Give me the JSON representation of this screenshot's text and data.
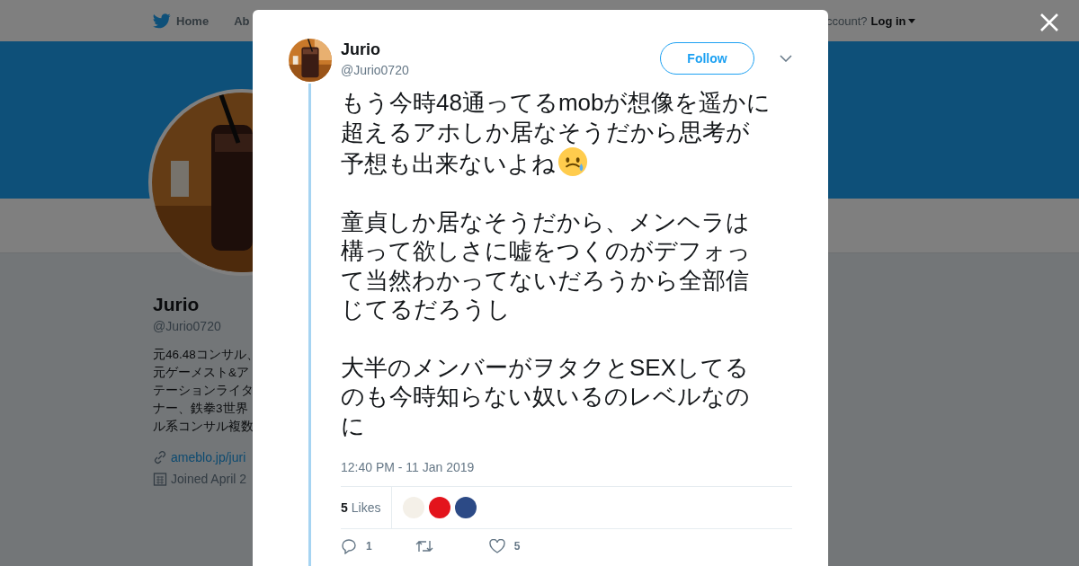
{
  "nav": {
    "home": "Home",
    "about": "Ab",
    "account": "ccount?",
    "login": "Log in"
  },
  "profile": {
    "name": "Jurio",
    "handle": "@Jurio0720",
    "bio_lines": [
      "元46.48コンサル、",
      "元ゲーメスト&ア",
      "テーションライタ",
      "ナー、鉄拳3世界",
      "ル系コンサル複数"
    ],
    "link": "ameblo.jp/juri",
    "joined": "Joined April 2"
  },
  "tweet": {
    "name": "Jurio",
    "handle": "@Jurio0720",
    "follow": "Follow",
    "paragraphs": [
      {
        "lines": [
          "もう今時48通ってるmobが想像を遥かに",
          "超えるアホしか居なそうだから思考が",
          "予想も出来ないよね"
        ],
        "emoji": true
      },
      {
        "lines": [
          "童貞しか居なそうだから、メンヘラは",
          "構って欲しさに嘘をつくのがデフォっ",
          "て当然わかってないだろうから全部信",
          "じてるだろうし"
        ],
        "emoji": false
      },
      {
        "lines": [
          "大半のメンバーがヲタクとSEXしてる",
          "のも今時知らない奴いるのレベルなの",
          "に"
        ],
        "emoji": false
      }
    ],
    "timestamp": "12:40 PM - 11 Jan 2019",
    "likes_count": "5",
    "likes_label": "Likes",
    "likers": [
      {
        "color": "#f4f0e8"
      },
      {
        "color": "#e3141c"
      },
      {
        "color": "#2c4a86"
      }
    ],
    "replies": "1",
    "likes": "5"
  }
}
